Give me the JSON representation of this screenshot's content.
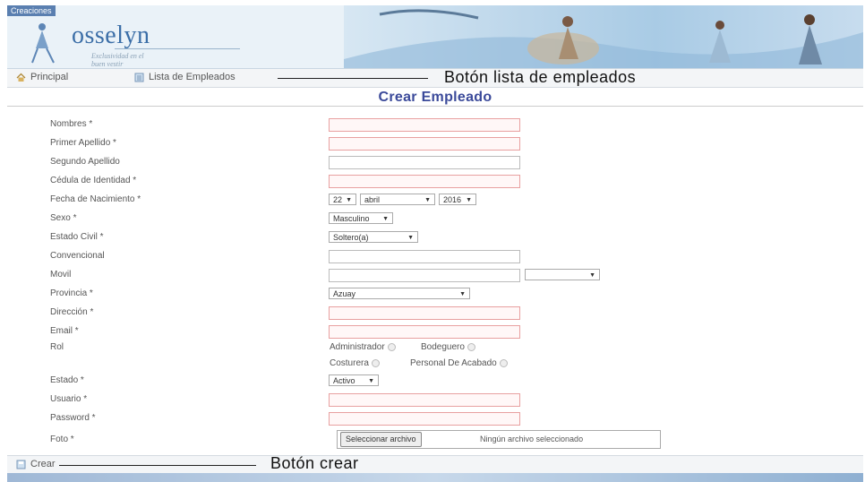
{
  "header": {
    "brand_tag": "Creaciones",
    "logo_word": "osselyn",
    "logo_tagline": "Exclusividad en el buen vestir"
  },
  "nav": {
    "principal": "Principal",
    "lista": "Lista de Empleados",
    "annotation": "Botón lista de empleados"
  },
  "form": {
    "title": "Crear Empleado",
    "fields": {
      "nombres": "Nombres *",
      "primer_apellido": "Primer Apellido *",
      "segundo_apellido": "Segundo Apellido",
      "cedula": "Cédula de Identidad *",
      "fecha_nacimiento": "Fecha de Nacimiento *",
      "sexo": "Sexo *",
      "estado_civil": "Estado Civil *",
      "convencional": "Convencional",
      "movil": "Movil",
      "provincia": "Provincia *",
      "direccion": "Dirección *",
      "email": "Email *",
      "rol": "Rol",
      "estado": "Estado *",
      "usuario": "Usuario *",
      "password": "Password *",
      "foto": "Foto *"
    },
    "values": {
      "dia": "22",
      "mes": "abril",
      "anio": "2016",
      "sexo": "Masculino",
      "estado_civil": "Soltero(a)",
      "provincia": "Azuay",
      "estado": "Activo"
    },
    "roles": [
      "Administrador",
      "Bodeguero",
      "Costurera",
      "Personal De Acabado"
    ],
    "file_button": "Seleccionar archivo",
    "file_status": "Ningún archivo seleccionado"
  },
  "bottom": {
    "crear": "Crear",
    "annotation": "Botón crear"
  }
}
